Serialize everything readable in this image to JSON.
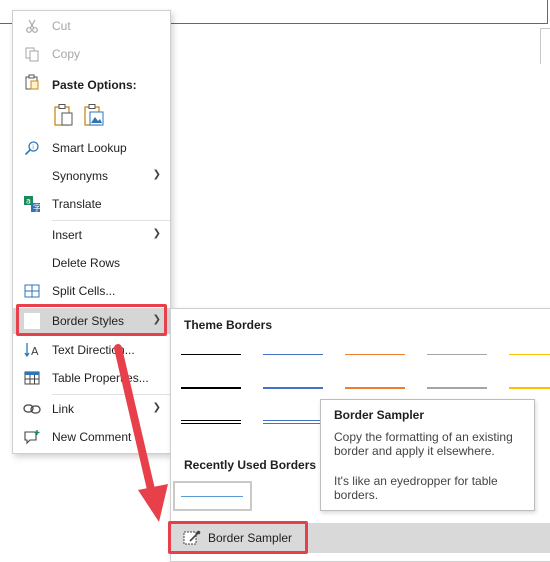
{
  "context_menu": {
    "cut": "Cut",
    "copy": "Copy",
    "paste_options": "Paste Options:",
    "smart_lookup": "Smart Lookup",
    "synonyms": "Synonyms",
    "translate": "Translate",
    "insert": "Insert",
    "delete_rows": "Delete Rows",
    "split_cells": "Split Cells...",
    "border_styles": "Border Styles",
    "text_direction": "Text Direction...",
    "table_properties": "Table Properties...",
    "link": "Link",
    "new_comment": "New Comment"
  },
  "flyout": {
    "theme_borders": "Theme Borders",
    "recently_used": "Recently Used Borders",
    "border_sampler": "Border Sampler",
    "border_colors": [
      "#000000",
      "#4472c4",
      "#ed7d31",
      "#a5a5a5",
      "#ffc000"
    ]
  },
  "tooltip": {
    "title": "Border Sampler",
    "line1": "Copy the formatting of an existing border and apply it elsewhere.",
    "line2": "It's like an eyedropper for table borders."
  },
  "colors": {
    "annotation_red": "#e8404a",
    "highlight": "#d6d6d6"
  }
}
